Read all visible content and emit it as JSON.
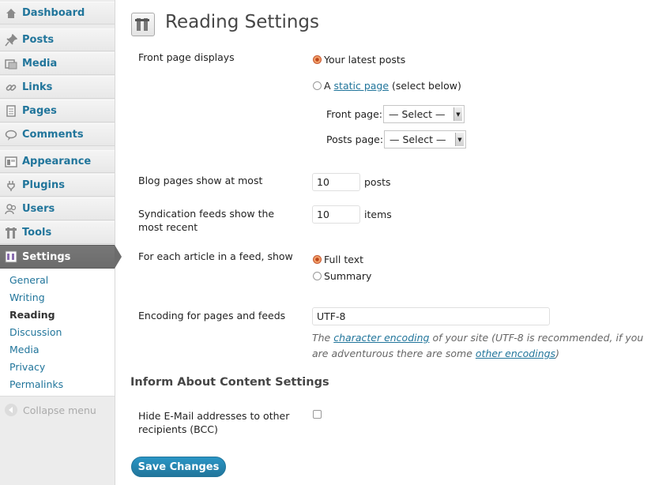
{
  "menu": [
    {
      "label": "Dashboard",
      "icon": "dashboard-icon"
    },
    {
      "label": "Posts",
      "icon": "pin-icon"
    },
    {
      "label": "Media",
      "icon": "media-icon"
    },
    {
      "label": "Links",
      "icon": "link-icon"
    },
    {
      "label": "Pages",
      "icon": "pages-icon"
    },
    {
      "label": "Comments",
      "icon": "comment-icon"
    },
    {
      "label": "Appearance",
      "icon": "appearance-icon"
    },
    {
      "label": "Plugins",
      "icon": "plug-icon"
    },
    {
      "label": "Users",
      "icon": "users-icon"
    },
    {
      "label": "Tools",
      "icon": "tools-icon"
    },
    {
      "label": "Settings",
      "icon": "settings-icon"
    }
  ],
  "submenu": [
    "General",
    "Writing",
    "Reading",
    "Discussion",
    "Media",
    "Privacy",
    "Permalinks"
  ],
  "collapse_label": "Collapse menu",
  "page": {
    "title": "Reading Settings",
    "front_page_displays": {
      "label": "Front page displays",
      "latest_posts": "Your latest posts",
      "static_prefix": "A",
      "static_link": "static page",
      "static_suffix": "(select below)",
      "front_page_label": "Front page:",
      "posts_page_label": "Posts page:",
      "front_page_value": "— Select —",
      "posts_page_value": "— Select —"
    },
    "blog_pages": {
      "label": "Blog pages show at most",
      "value": "10",
      "suffix": "posts"
    },
    "feeds": {
      "label": "Syndication feeds show the most recent",
      "value": "10",
      "suffix": "items"
    },
    "feed_article": {
      "label": "For each article in a feed, show",
      "full_text": "Full text",
      "summary": "Summary"
    },
    "encoding": {
      "label": "Encoding for pages and feeds",
      "value": "UTF-8",
      "desc_1": "The",
      "desc_link_1": "character encoding",
      "desc_2": "of your site (UTF-8 is recommended, if you are adventurous there are some",
      "desc_link_2": "other encodings",
      "desc_3": ")"
    },
    "section_title": "Inform About Content Settings",
    "bcc": {
      "label": "Hide E-Mail addresses to other recipients (BCC)"
    },
    "save_label": "Save Changes"
  },
  "colors": {
    "link": "#21759b",
    "active_menu": "#6c6c6c",
    "radio_checked": "#c0461b"
  }
}
